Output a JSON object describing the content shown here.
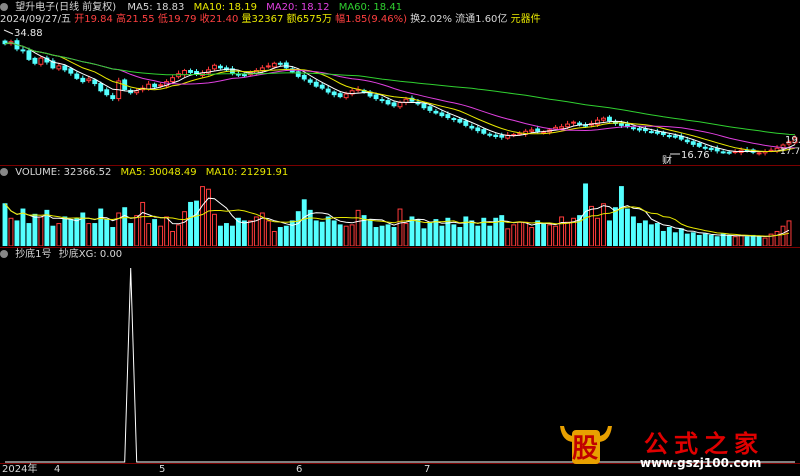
{
  "colors": {
    "up": "#ff3b3b",
    "down": "#54ffff",
    "ma5": "#ffffff",
    "ma10": "#e8e800",
    "ma20": "#e040e0",
    "ma60": "#30d030",
    "grid": "#7a0000",
    "signal": "#ffffff"
  },
  "header": {
    "stock": "望升电子(日线 前复权)",
    "ma5": "MA5: 18.83",
    "ma10": "MA10: 18.19",
    "ma20": "MA20: 18.12",
    "ma60": "MA60: 18.41"
  },
  "info": {
    "date": "2024/09/27/五",
    "open": "开19.84",
    "high": "高21.55",
    "low": "低19.79",
    "close": "收21.40",
    "vol": "量32367",
    "amount": "额6575万",
    "change": "幅1.85(9.46%)",
    "turnover": "换2.02%",
    "float": "流通1.60亿",
    "sector": "元器件"
  },
  "price_labels": {
    "high": "34.88",
    "low": "16.76",
    "right_top": "19.",
    "right_low": "17.7",
    "cai": "财"
  },
  "volume_header": {
    "title": "VOLUME: 32366.52",
    "ma5": "MA5: 30048.49",
    "ma10": "MA10: 21291.91"
  },
  "indicator_header": {
    "name": "抄底1号",
    "xg": "抄底XG: 0.00"
  },
  "xaxis": {
    "labels": [
      "2024年",
      "4",
      "5",
      "6",
      "7"
    ]
  },
  "watermark": {
    "char": "股",
    "brand": "公式之家",
    "url": "www.gszj100.com"
  },
  "chart_data": [
    {
      "type": "candlestick",
      "title": "望升电子(日线 前复权)",
      "annotations": [
        "34.88",
        "16.76"
      ],
      "close": [
        33.6,
        33.9,
        32.8,
        32.5,
        31.2,
        30.6,
        31.4,
        30.8,
        29.9,
        30.2,
        29.6,
        29.1,
        28.3,
        27.8,
        28.2,
        27.5,
        26.4,
        25.8,
        25.2,
        27.9,
        26.6,
        26.1,
        26.4,
        26.8,
        27.4,
        27.0,
        27.3,
        27.8,
        28.4,
        29.0,
        29.5,
        29.2,
        28.9,
        29.1,
        29.6,
        30.3,
        29.9,
        29.6,
        29.1,
        28.9,
        28.7,
        29.2,
        29.5,
        29.9,
        30.2,
        30.6,
        30.5,
        29.9,
        29.3,
        28.6,
        28.2,
        27.7,
        27.1,
        26.8,
        26.2,
        25.8,
        25.5,
        25.9,
        26.4,
        26.6,
        26.2,
        25.6,
        25.2,
        24.9,
        24.4,
        24.1,
        24.6,
        25.1,
        24.8,
        24.4,
        23.8,
        23.4,
        23.0,
        22.6,
        22.3,
        22.0,
        21.6,
        21.1,
        20.7,
        20.3,
        19.9,
        19.6,
        19.4,
        19.3,
        19.6,
        19.7,
        19.9,
        20.2,
        20.4,
        20.2,
        20.1,
        20.4,
        20.8,
        20.9,
        21.3,
        21.6,
        21.2,
        21.0,
        21.4,
        21.9,
        22.2,
        21.8,
        21.4,
        21.1,
        20.9,
        20.6,
        20.4,
        20.3,
        20.1,
        19.9,
        19.7,
        19.5,
        19.3,
        19.0,
        18.6,
        18.2,
        17.9,
        17.6,
        17.4,
        17.2,
        17.0,
        16.9,
        17.1,
        17.3,
        17.2,
        17.0,
        16.9,
        17.1,
        17.3,
        17.6,
        18.1,
        18.6,
        19.2
      ],
      "ma5_last": 18.83,
      "ma10_last": 18.19,
      "ma20_last": 18.12,
      "ma60_last": 18.41
    },
    {
      "type": "bar",
      "title": "VOLUME: 32366.52",
      "values": [
        32,
        21,
        19,
        28,
        17,
        24,
        22,
        27,
        15,
        17,
        22,
        20,
        21,
        25,
        17,
        17,
        28,
        20,
        14,
        25,
        29,
        17,
        23,
        33,
        17,
        20,
        15,
        22,
        11,
        16,
        26,
        33,
        34,
        45,
        43,
        24,
        15,
        17,
        15,
        21,
        19,
        19,
        22,
        25,
        19,
        11,
        14,
        15,
        19,
        26,
        35,
        27,
        19,
        18,
        22,
        19,
        16,
        15,
        16,
        27,
        23,
        20,
        14,
        15,
        16,
        14,
        28,
        17,
        22,
        20,
        13,
        18,
        20,
        15,
        21,
        16,
        14,
        22,
        19,
        15,
        21,
        15,
        21,
        23,
        13,
        16,
        18,
        18,
        14,
        19,
        17,
        16,
        15,
        22,
        18,
        21,
        23,
        47,
        30,
        21,
        32,
        19,
        29,
        45,
        28,
        22,
        17,
        19,
        16,
        17,
        11,
        14,
        10,
        13,
        9,
        10,
        8,
        9,
        8,
        7,
        9,
        8,
        7,
        8,
        7,
        8,
        7,
        6,
        9,
        11,
        15,
        19
      ],
      "ma5_last": 30048.49,
      "ma10_last": 21291.91
    },
    {
      "type": "line",
      "title": "抄底1号",
      "series": [
        {
          "name": "抄底XG",
          "values_note": "single spike",
          "spike_index": 21,
          "spike_value": 1,
          "last": 0.0
        }
      ]
    }
  ]
}
